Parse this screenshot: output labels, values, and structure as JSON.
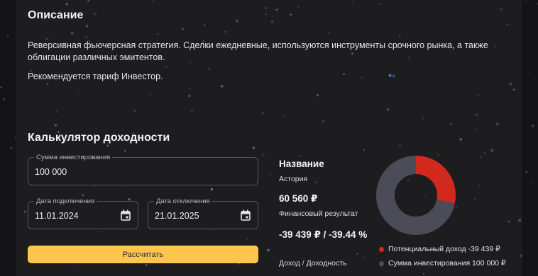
{
  "description": {
    "title": "Описание",
    "text": "Реверсивная фьючерсная стратегия. Сделки ежедневные, используются инструменты срочного рынка, а также облигации различных эмитентов.",
    "recommendation": "Рекомендуется тариф Инвестор."
  },
  "calculator": {
    "title": "Калькулятор доходности",
    "amount": {
      "label": "Сумма инвестирования",
      "value": "100 000"
    },
    "start_date": {
      "label": "Дата подключения",
      "value": "11.01.2024"
    },
    "end_date": {
      "label": "Дата отключения",
      "value": "21.01.2025"
    },
    "button_label": "Рассчитать"
  },
  "result": {
    "name_title": "Название",
    "name_value": "Астория",
    "financial_value": "60 560 ₽",
    "financial_label": "Финансовый результат",
    "income_value": "-39 439 ₽ / -39.44 %",
    "income_label": "Доход / Доходность"
  },
  "chart_data": {
    "type": "pie",
    "series": [
      {
        "name": "Потенциальный доход -39 439 ₽",
        "value": 39439,
        "color": "#d2291e"
      },
      {
        "name": "Сумма инвестирования 100 000 ₽",
        "value": 100000,
        "color": "#4c4b58"
      }
    ]
  },
  "colors": {
    "accent": "#fdc54b",
    "income": "#d2291e",
    "investment": "#4c4b58"
  }
}
